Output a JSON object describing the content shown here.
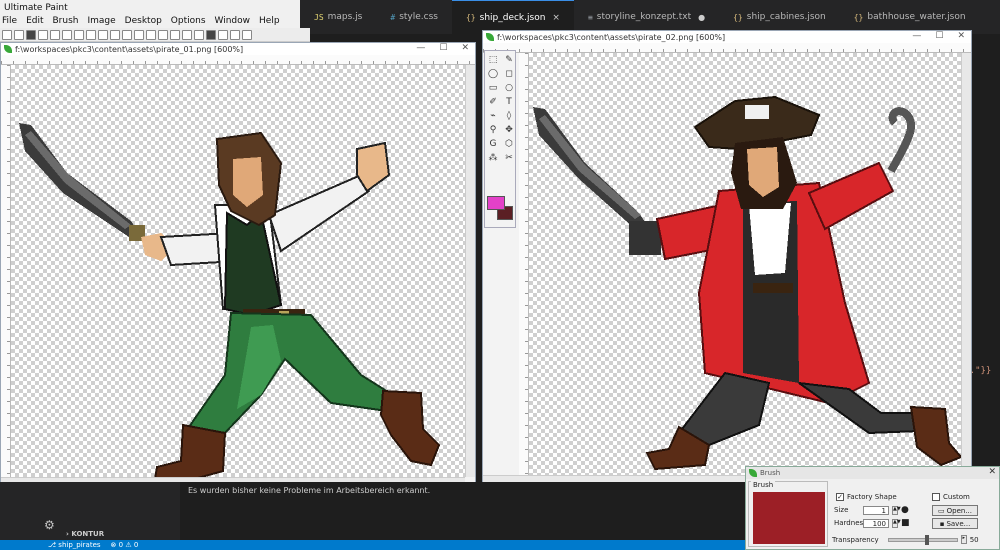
{
  "app": {
    "title": "Ultimate Paint",
    "menu": [
      "File",
      "Edit",
      "Brush",
      "Image",
      "Desktop",
      "Options",
      "Window",
      "Help"
    ]
  },
  "editor": {
    "tabs": [
      {
        "icon": "JS",
        "label": "maps.js",
        "state": ""
      },
      {
        "icon": "#",
        "label": "style.css",
        "state": ""
      },
      {
        "icon": "{}",
        "label": "ship_deck.json",
        "state": "×"
      },
      {
        "icon": "≡",
        "label": "storyline_konzept.txt",
        "state": "●"
      },
      {
        "icon": "{}",
        "label": "ship_cabines.json",
        "state": ""
      },
      {
        "icon": "{}",
        "label": "bathhouse_water.json",
        "state": ""
      }
    ],
    "code_fragment": "egan.\"}}"
  },
  "windows": {
    "left": {
      "title": "f:\\workspaces\\pkc3\\content\\assets\\pirate_01.png [600%]"
    },
    "right": {
      "title": "f:\\workspaces\\pkc3\\content\\assets\\pirate_02.png [600%]"
    }
  },
  "tools": {
    "items": [
      "⬚",
      "✎",
      "◯",
      "◻",
      "▭",
      "○",
      "✐",
      "T",
      "⌁",
      "◊",
      "⚲",
      "✥",
      "G",
      "⬡",
      "⁂",
      "✂"
    ],
    "primary_color": "#e341c8",
    "secondary_color": "#5b1f24"
  },
  "problems": {
    "message": "Es wurden bisher keine Probleme im Arbeitsbereich erkannt."
  },
  "sidebar": {
    "section": "KONTUR"
  },
  "statusbar": {
    "branch": "ship_pirates",
    "errors": "0",
    "warnings": "0"
  },
  "brush": {
    "title": "Brush",
    "group_label": "Brush",
    "preview_color": "#9c1f26",
    "factory_shape_label": "Factory Shape",
    "custom_label": "Custom",
    "size_label": "Size",
    "size_value": "1",
    "hardness_label": "Hardness",
    "hardness_value": "100",
    "open_label": "Open...",
    "save_label": "Save...",
    "transparency_label": "Transparency",
    "transparency_value": "50"
  }
}
